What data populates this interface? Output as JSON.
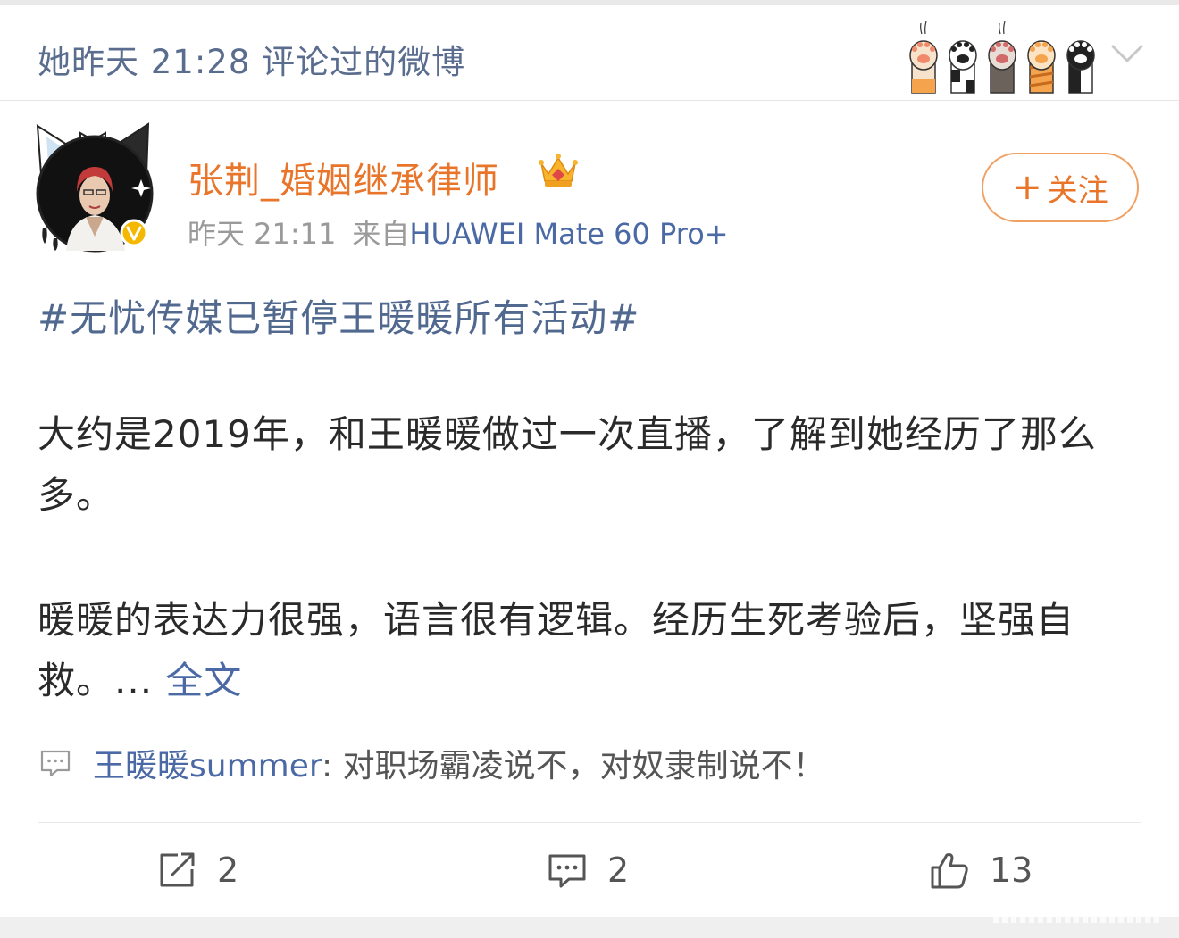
{
  "header": {
    "title": "她昨天 21:28 评论过的微博",
    "decoration_icon": "cat-paws-icon",
    "dropdown_icon": "chevron-down-icon"
  },
  "post": {
    "username": "张荆_婚姻继承律师",
    "badge_icon": "crown-icon",
    "verified_icon": "verified-v-icon",
    "time": "昨天 21:11",
    "source_prefix": "来自",
    "device": "HUAWEI Mate 60 Pro+",
    "follow_label": "关注",
    "follow_plus": "+",
    "topic": "#无忧传媒已暂停王暖暖所有活动#",
    "paragraph1": "大约是2019年，和王暖暖做过一次直播，了解到她经历了那么多。",
    "paragraph2": "暖暖的表达力很强，语言很有逻辑。经历生死考验后，坚强自救。... ",
    "full_text_link": "全文",
    "quote_comment": {
      "user": "王暖暖summer",
      "text": ": 对职场霸凌说不，对奴隶制说不！"
    }
  },
  "actions": {
    "repost_count": "2",
    "comment_count": "2",
    "like_count": "13"
  },
  "colors": {
    "accent_orange": "#e8752a",
    "link_blue": "#4b6aa5",
    "header_blue_gray": "#5a6d8f"
  }
}
